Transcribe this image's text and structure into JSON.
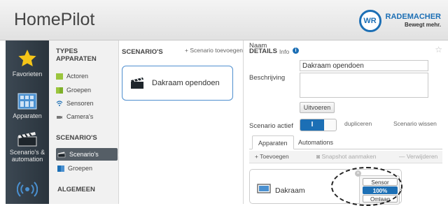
{
  "header": {
    "app_title": "HomePilot",
    "brand_name": "RADEMACHER",
    "brand_tagline": "Bewegt mehr."
  },
  "sidebar": {
    "items": [
      {
        "label": "Favorieten",
        "icon": "star-icon"
      },
      {
        "label": "Apparaten",
        "icon": "devices-icon"
      },
      {
        "label": "Scenario's & automation",
        "icon": "scenario-icon"
      },
      {
        "label": "",
        "icon": "sensor-wave-icon"
      }
    ]
  },
  "nav": {
    "types_heading_line1": "TYPES",
    "types_heading_line2": "APPARATEN",
    "types_items": [
      {
        "label": "Actoren",
        "icon": "actor-icon"
      },
      {
        "label": "Groepen",
        "icon": "groups-icon"
      },
      {
        "label": "Sensoren",
        "icon": "wifi-icon"
      },
      {
        "label": "Camera's",
        "icon": "camera-icon"
      }
    ],
    "scenarios_heading": "SCENARIO'S",
    "scenarios_items": [
      {
        "label": "Scenario's",
        "icon": "clapper-icon",
        "selected": true
      },
      {
        "label": "Groepen",
        "icon": "groups-icon"
      }
    ],
    "general_heading": "ALGEMEEN"
  },
  "scenarios": {
    "heading": "SCENARIO'S",
    "add_label": "+ Scenario toevoegen",
    "cards": [
      {
        "label": "Dakraam opendoen",
        "icon": "clapper-icon"
      }
    ]
  },
  "details": {
    "title": "DETAILS",
    "info_label": "Info",
    "name_label": "Naam",
    "name_value": "Dakraam opendoen",
    "description_label": "Beschrijving",
    "description_value": "",
    "execute_label": "Uitvoeren",
    "active_label": "Scenario actief",
    "toggle_label": "I",
    "duplicate_label": "dupliceren",
    "delete_label": "Scenario wissen",
    "tabs": [
      {
        "label": "Apparaten",
        "active": true
      },
      {
        "label": "Automations",
        "active": false
      }
    ],
    "toolbar": {
      "add_label": "+ Toevoegen",
      "snapshot_label": "Snapshot aanmaken",
      "remove_label": "— Verwijderen"
    },
    "device": {
      "label": "Dakraam",
      "states": [
        "Sensor",
        "100%",
        "Omlaag"
      ],
      "selected_state": "100%"
    }
  },
  "colors": {
    "accent": "#1c6fb5",
    "sidebar_bg": "#2f3a44",
    "star": "#f5c518"
  }
}
